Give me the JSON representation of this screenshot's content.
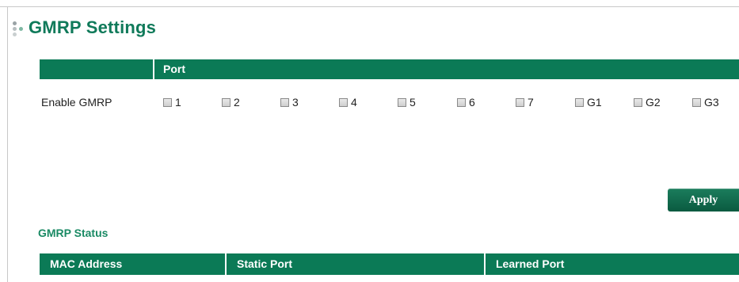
{
  "page": {
    "title": "GMRP Settings"
  },
  "settings": {
    "port_header": "Port",
    "enable_label": "Enable GMRP",
    "ports": [
      {
        "label": "1",
        "checked": false
      },
      {
        "label": "2",
        "checked": false
      },
      {
        "label": "3",
        "checked": false
      },
      {
        "label": "4",
        "checked": false
      },
      {
        "label": "5",
        "checked": false
      },
      {
        "label": "6",
        "checked": false
      },
      {
        "label": "7",
        "checked": false
      },
      {
        "label": "G1",
        "checked": false
      },
      {
        "label": "G2",
        "checked": false
      },
      {
        "label": "G3",
        "checked": false
      }
    ],
    "apply_label": "Apply"
  },
  "status": {
    "title": "GMRP Status",
    "columns": [
      "MAC Address",
      "Static Port",
      "Learned Port"
    ]
  },
  "colors": {
    "header_bg": "#0b7a56",
    "title_text": "#107a5a",
    "section_title": "#1a8a64"
  }
}
